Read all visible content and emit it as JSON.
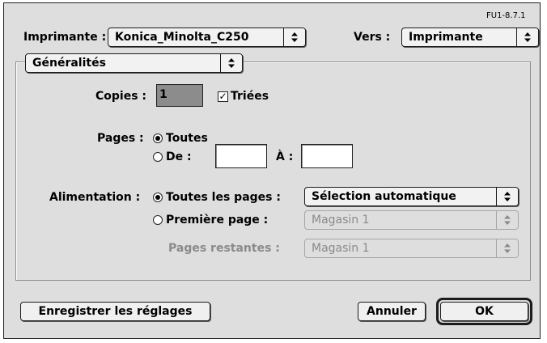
{
  "version_label": "FU1-8.7.1",
  "printer": {
    "label": "Imprimante :",
    "value": "Konica_Minolta_C250"
  },
  "destination": {
    "label": "Vers :",
    "value": "Imprimante"
  },
  "panel": {
    "value": "Généralités"
  },
  "copies": {
    "label": "Copies :",
    "value": "1",
    "collate_label": "Triées",
    "collate_checked": true
  },
  "pages": {
    "label": "Pages :",
    "all_label": "Toutes",
    "range_label": "De :",
    "to_label": "À :",
    "from_value": "",
    "to_value": "",
    "selected": "all"
  },
  "paper_source": {
    "label": "Alimentation :",
    "all_pages_label": "Toutes les pages :",
    "all_pages_value": "Sélection automatique",
    "first_page_label": "Première page :",
    "first_page_value": "Magasin 1",
    "remaining_label": "Pages restantes :",
    "remaining_value": "Magasin 1",
    "selected": "all_pages"
  },
  "buttons": {
    "save_settings": "Enregistrer les réglages",
    "cancel": "Annuler",
    "ok": "OK"
  },
  "icons": {
    "popup_arrow": "updown-arrows-icon",
    "check": "checkmark-icon"
  }
}
